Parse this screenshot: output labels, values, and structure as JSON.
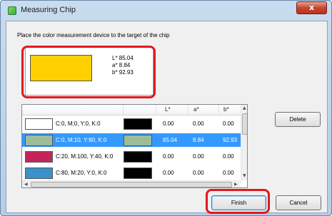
{
  "window": {
    "title": "Measuring Chip",
    "close_glyph": "x"
  },
  "instruction": "Place the color measurement device to the target of the chip",
  "preview": {
    "swatch_color": "#ffd000",
    "lab_l": "L* 85.04",
    "lab_a": "a* 8.84",
    "lab_b": "b* 92.93"
  },
  "table": {
    "headers": {
      "l": "L*",
      "a": "a*",
      "b": "b*"
    },
    "rows": [
      {
        "swatch": "#ffffff",
        "name": "C:0, M:0, Y:0, K:0",
        "target": "#000000",
        "l": "0.00",
        "a": "0.00",
        "b": "0.00",
        "selected": false
      },
      {
        "swatch": "#9dbd99",
        "name": "C:0, M:10, Y:90, K:0",
        "target": "#9dbd99",
        "l": "85.04",
        "a": "8.84",
        "b": "92.93",
        "selected": true
      },
      {
        "swatch": "#c4245c",
        "name": "C:20, M:100, Y:40, K:0",
        "target": "#000000",
        "l": "0.00",
        "a": "0.00",
        "b": "0.00",
        "selected": false
      },
      {
        "swatch": "#3c91cb",
        "name": "C:80, M:20, Y:0, K:0",
        "target": "#000000",
        "l": "0.00",
        "a": "0.00",
        "b": "0.00",
        "selected": false
      }
    ]
  },
  "buttons": {
    "delete": "Delete",
    "finish": "Finish",
    "cancel": "Cancel"
  },
  "colors": {
    "highlight": "#e0191e",
    "selection": "#3399ff"
  }
}
